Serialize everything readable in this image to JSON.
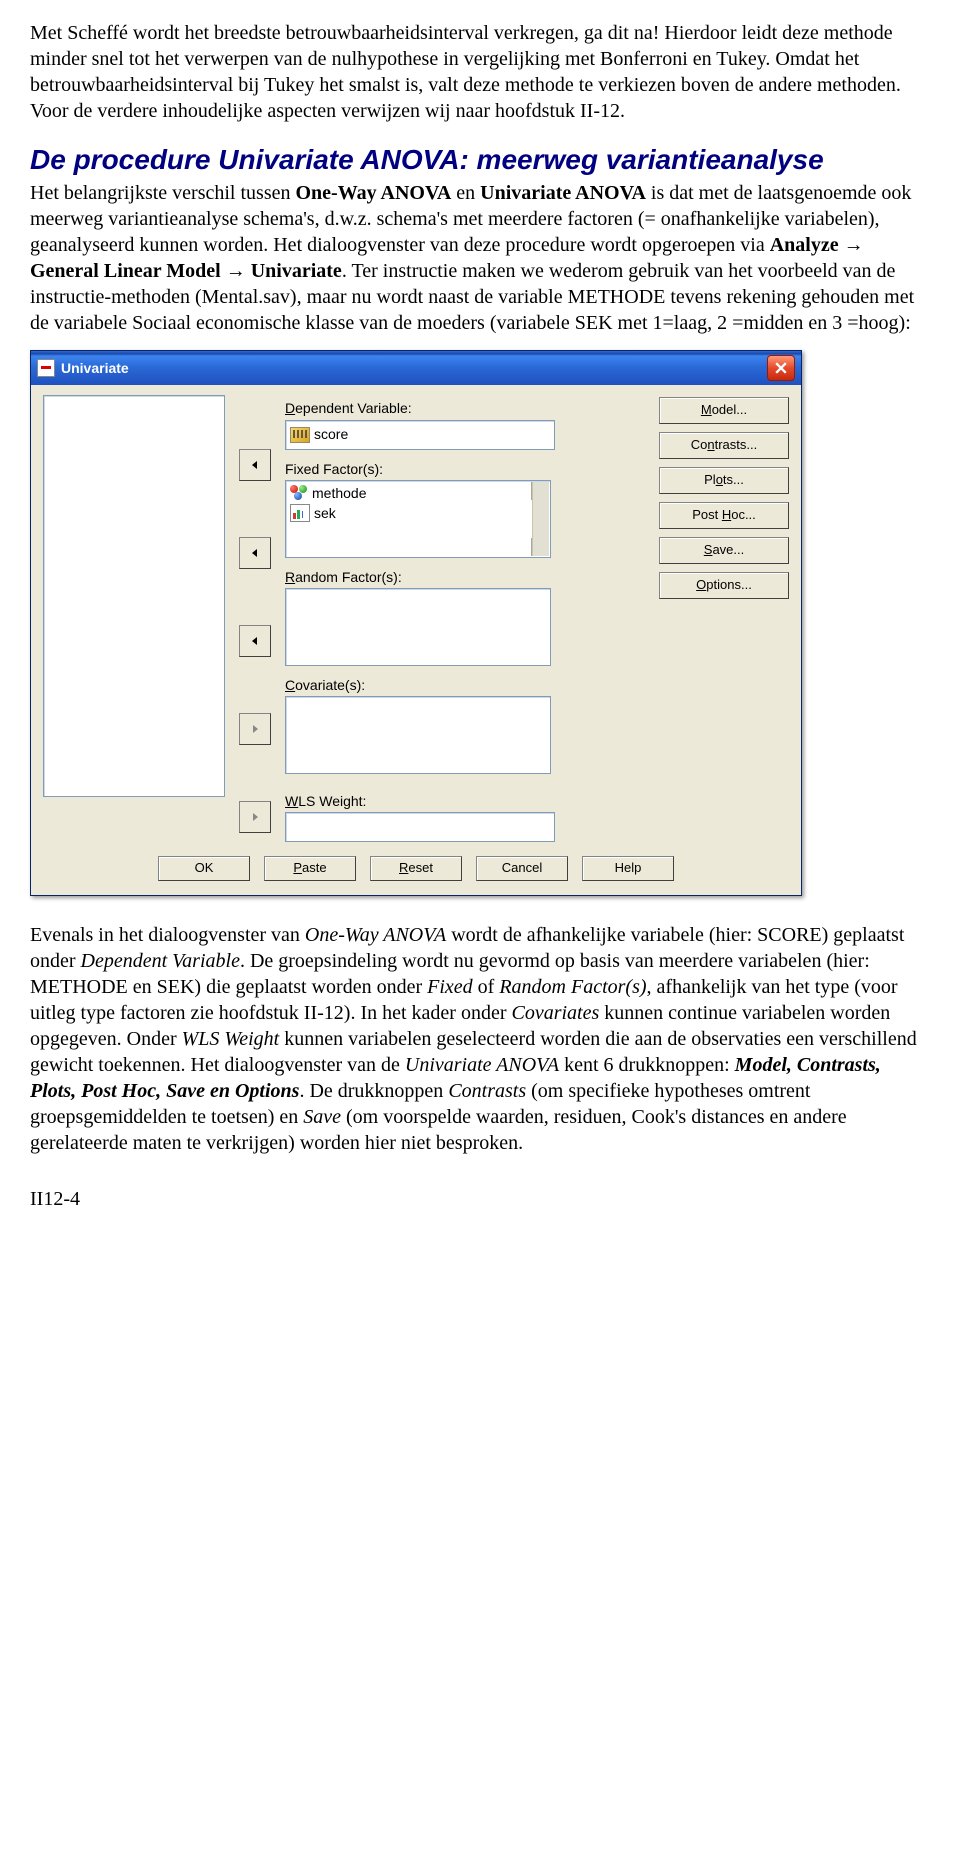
{
  "para1": "Met Scheffé wordt het breedste betrouwbaarheidsinterval verkregen, ga dit na! Hierdoor leidt deze methode minder snel tot het verwerpen van de nulhypothese in vergelijking met Bonferroni en Tukey. Omdat het betrouwbaarheidsinterval bij Tukey het smalst is, valt deze methode te verkiezen boven de andere methoden. Voor de verdere inhoudelijke aspecten verwijzen wij naar hoofdstuk II-12.",
  "heading": "De procedure Univariate ANOVA: meerweg variantieanalyse",
  "para2_a": "Het belangrijkste verschil tussen ",
  "para2_b": "One-Way ANOVA",
  "para2_c": " en ",
  "para2_d": "Univariate ANOVA",
  "para2_e": " is dat met de laatsgenoemde ook meerweg variantieanalyse schema's, d.w.z. schema's met meerdere factoren (= onafhankelijke variabelen), geanalyseerd kunnen worden. Het dialoogvenster van deze procedure wordt opgeroepen via ",
  "para2_f": "Analyze → General Linear Model → Univariate",
  "para2_g": ". Ter instructie maken we wederom gebruik van het voorbeeld van de instructie-methoden (Mental.sav), maar nu wordt naast de variable METHODE tevens rekening gehouden met de variabele Sociaal economische klasse van de moeders (variabele SEK met 1=laag, 2 =midden en 3 =hoog):",
  "dialog": {
    "title": "Univariate",
    "labels": {
      "dep_pre": "D",
      "dep_rest": "ependent Variable:",
      "fixed": "Fixed Factor(s):",
      "rand_pre": "R",
      "rand_rest": "andom Factor(s):",
      "cov_pre": "C",
      "cov_rest": "ovariate(s):",
      "wls_pre": "W",
      "wls_rest": "LS Weight:"
    },
    "dep_value": "score",
    "fixed_values": [
      "methode",
      "sek"
    ],
    "right_btns": {
      "model_pre": "M",
      "model_rest": "odel...",
      "contrasts_pre": "Co",
      "contrasts_ul": "n",
      "contrasts_rest": "trasts...",
      "plots_pre": "Pl",
      "plots_ul": "o",
      "plots_rest": "ts...",
      "posthoc_pre": "Post ",
      "posthoc_ul": "H",
      "posthoc_rest": "oc...",
      "save_ul": "S",
      "save_rest": "ave...",
      "options_ul": "O",
      "options_rest": "ptions..."
    },
    "foot": {
      "ok": "OK",
      "paste_ul": "P",
      "paste_rest": "aste",
      "reset_ul": "R",
      "reset_rest": "eset",
      "cancel": "Cancel",
      "help": "Help"
    }
  },
  "para3_a": "Evenals in het dialoogvenster van ",
  "para3_b": "One-Way ANOVA",
  "para3_c": " wordt de afhankelijke variabele (hier: SCORE) geplaatst onder ",
  "para3_d": "Dependent Variable",
  "para3_e": ". De groepsindeling wordt nu gevormd op basis van meerdere variabelen (hier: METHODE en SEK) die geplaatst worden onder ",
  "para3_f": "Fixed",
  "para3_g": " of ",
  "para3_h": "Random Factor(s)",
  "para3_i": ", afhankelijk van het type (voor uitleg type factoren zie hoofdstuk II-12). In het kader onder ",
  "para3_j": "Covariates",
  "para3_k": " kunnen continue variabelen worden opgegeven. Onder ",
  "para3_l": "WLS Weight",
  "para3_m": " kunnen variabelen geselecteerd worden die aan de observaties een verschillend gewicht toekennen. Het dialoogvenster van de ",
  "para3_n": "Univariate  ANOVA",
  "para3_o": " kent 6 drukknoppen: ",
  "para3_p": "Model, Contrasts, Plots, Post Hoc, Save en Options",
  "para3_q": ". De drukknoppen ",
  "para3_r": "Contrasts",
  "para3_s": " (om specifieke hypotheses omtrent groepsgemiddelden te toetsen) en ",
  "para3_t": "Save",
  "para3_u": " (om voorspelde waarden, residuen, Cook's distances en andere gerelateerde maten te verkrijgen) worden hier niet besproken.",
  "pagenum": "II12-4"
}
